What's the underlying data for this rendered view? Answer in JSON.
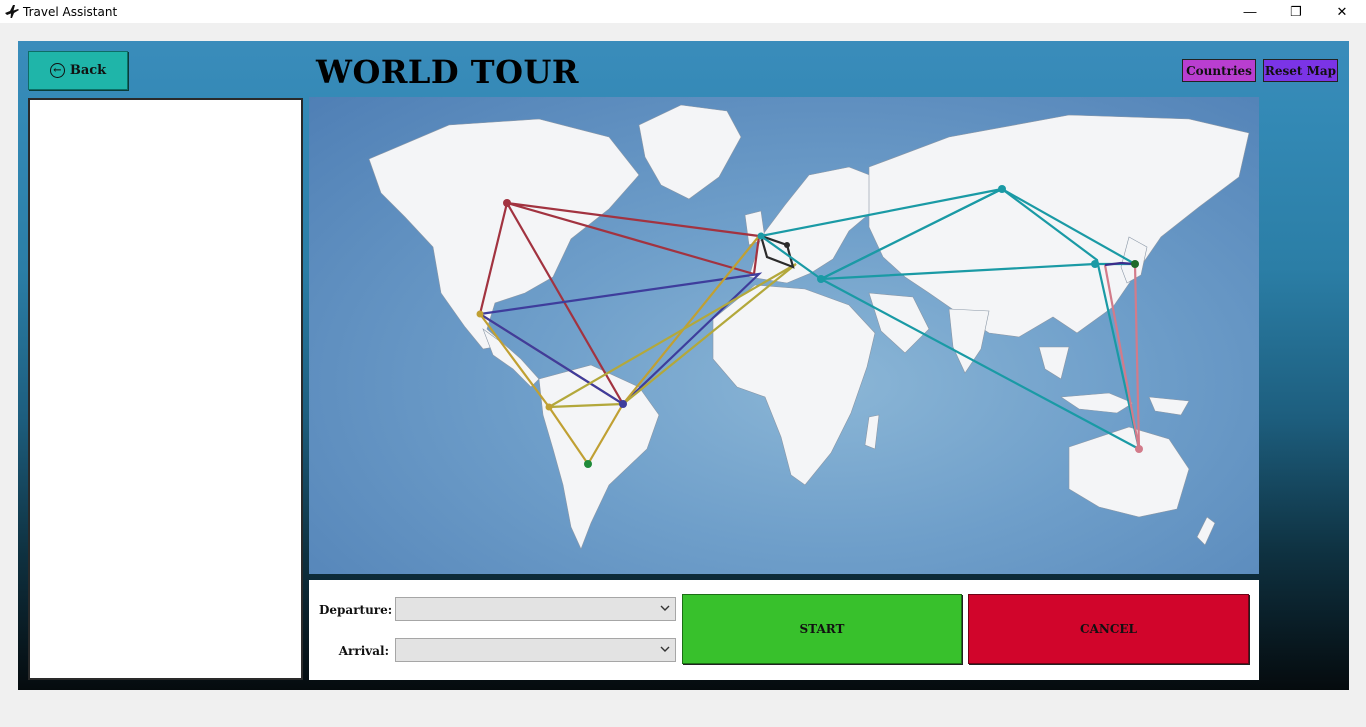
{
  "window": {
    "title": "Travel Assistant",
    "minimize_glyph": "—",
    "maximize_glyph": "❐",
    "close_glyph": "✕"
  },
  "header": {
    "back_label": "Back",
    "page_title": "WORLD TOUR",
    "countries_label": "Countries",
    "reset_map_label": "Reset Map"
  },
  "form": {
    "departure_label": "Departure:",
    "arrival_label": "Arrival:",
    "departure_value": "",
    "arrival_value": "",
    "start_label": "START",
    "cancel_label": "CANCEL"
  },
  "colors": {
    "back_button": "#1fb5a9",
    "countries_button": "#b93ed0",
    "reset_button": "#7b34e6",
    "start_button": "#38c12c",
    "cancel_button": "#d1052b",
    "ocean": "#6f9fca",
    "land": "#f4f5f7"
  },
  "icons": {
    "app": "airplane-icon",
    "back": "arrow-left-circle-icon",
    "dropdown": "chevron-down-icon"
  }
}
